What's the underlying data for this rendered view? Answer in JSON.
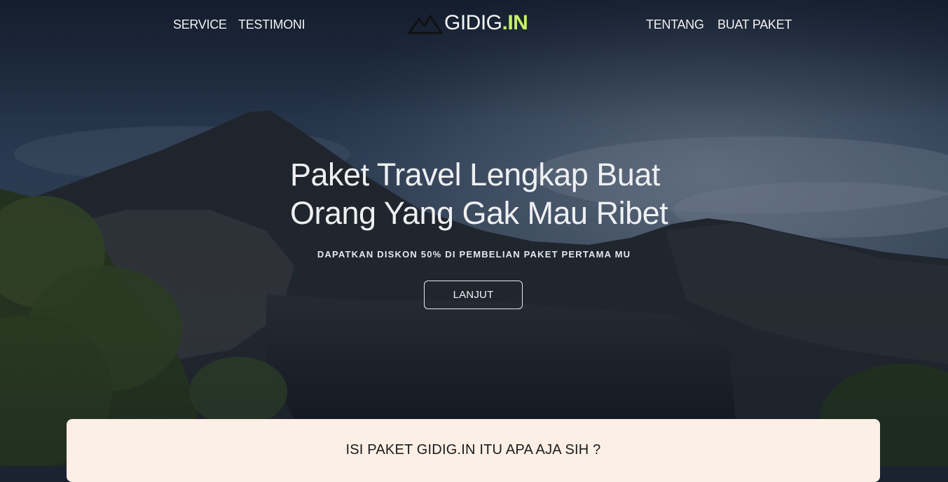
{
  "nav": {
    "left": [
      {
        "label": "SERVICE"
      },
      {
        "label": "TESTIMONI"
      }
    ],
    "right": [
      {
        "label": "TENTANG"
      },
      {
        "label": "BUAT PAKET"
      }
    ]
  },
  "logo": {
    "text_main": "GIDIG",
    "text_accent": ".IN",
    "icon": "mountain-icon",
    "accent_color": "#c8f06a"
  },
  "hero": {
    "title_line1": "Paket Travel Lengkap Buat",
    "title_line2": "Orang Yang Gak Mau Ribet",
    "subtitle": "DAPATKAN DISKON 50% DI PEMBELIAN PAKET PERTAMA MU",
    "cta_label": "LANJUT",
    "background": "mountain-landscape-image"
  },
  "info_card": {
    "title": "ISI PAKET GIDIG.IN ITU APA AJA SIH ?",
    "background_color": "#fbefe6"
  }
}
